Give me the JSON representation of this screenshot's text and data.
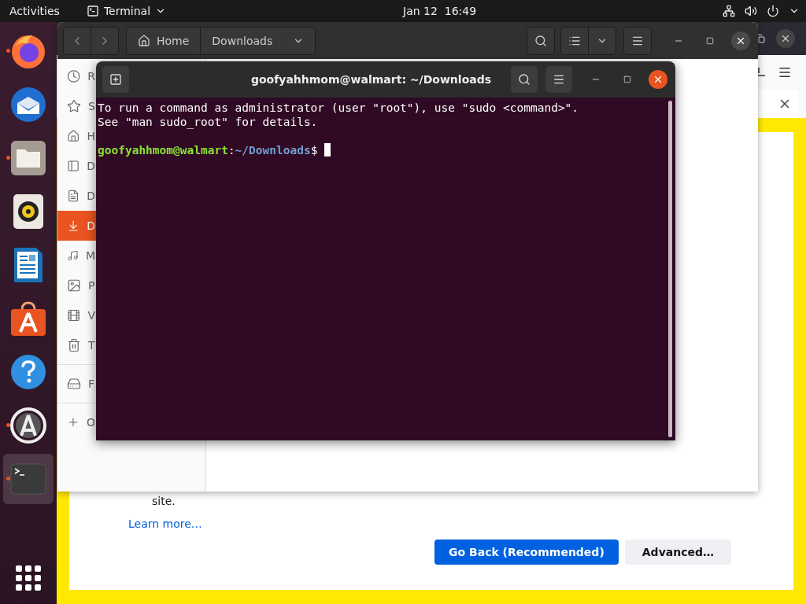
{
  "top_bar": {
    "activities": "Activities",
    "app_menu": "Terminal",
    "clock": "Jan 12  16:49"
  },
  "dock": {
    "apps": [
      {
        "kind": "firefox",
        "running": true,
        "selected": false
      },
      {
        "kind": "thunderbird",
        "running": false,
        "selected": false
      },
      {
        "kind": "files",
        "running": true,
        "selected": false
      },
      {
        "kind": "rhythmbox",
        "running": false,
        "selected": false
      },
      {
        "kind": "writer",
        "running": false,
        "selected": false
      },
      {
        "kind": "software",
        "running": false,
        "selected": false
      },
      {
        "kind": "help",
        "running": false,
        "selected": false
      },
      {
        "kind": "updater",
        "running": true,
        "selected": false
      },
      {
        "kind": "terminal",
        "running": true,
        "selected": true
      }
    ]
  },
  "browser": {
    "page": {
      "partial_text": "site.",
      "link": "Learn more…",
      "buttons": [
        {
          "label": "Go Back (Recommended)",
          "kind": "primary"
        },
        {
          "label": "Advanced…",
          "kind": "secondary"
        }
      ]
    }
  },
  "files_window": {
    "path": [
      "Home",
      "Downloads"
    ],
    "sidebar": [
      {
        "label": "R",
        "selected": false
      },
      {
        "label": "S",
        "selected": false
      },
      {
        "label": "H",
        "selected": false
      },
      {
        "label": "D",
        "selected": false
      },
      {
        "label": "D",
        "selected": false
      },
      {
        "label": "D",
        "selected": true
      },
      {
        "label": "M",
        "selected": false
      },
      {
        "label": "P",
        "selected": false
      },
      {
        "label": "V",
        "selected": false
      },
      {
        "label": "T",
        "selected": false
      },
      {
        "label": "F",
        "selected": false
      },
      {
        "label": "O",
        "selected": false
      }
    ]
  },
  "terminal": {
    "title": "goofyahhmom@walmart: ~/Downloads",
    "lines": [
      "To run a command as administrator (user \"root\"), use \"sudo <command>\".",
      "See \"man sudo_root\" for details."
    ],
    "prompt": {
      "user_host": "goofyahhmom@walmart",
      "separator": ":",
      "path": "~/Downloads",
      "symbol": "$"
    }
  }
}
